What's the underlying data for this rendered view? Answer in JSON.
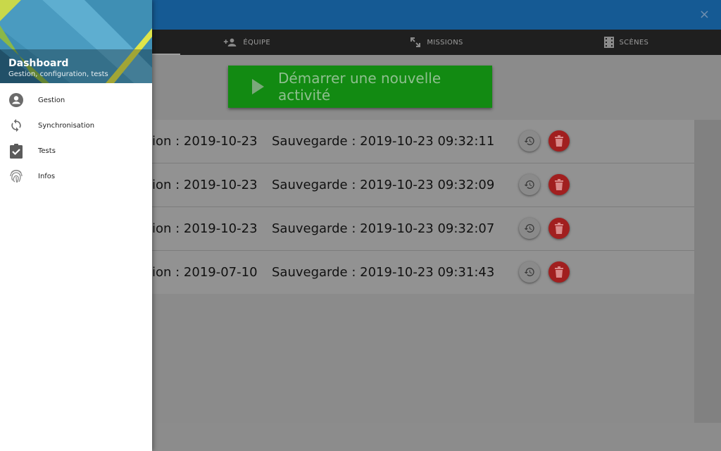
{
  "appbar": {
    "close_label": "×"
  },
  "tabs": [
    {
      "label": "ÉQUIPE",
      "icon": "group-add-icon"
    },
    {
      "label": "MISSIONS",
      "icon": "expand-arrows-icon"
    },
    {
      "label": "SCÈNES",
      "icon": "film-strip-icon"
    }
  ],
  "main": {
    "start_button_label": "Démarrer une nouvelle activité",
    "rows": [
      {
        "created": "ion : 2019-10-23",
        "saved": "Sauvegarde : 2019-10-23 09:32:11"
      },
      {
        "created": "ion : 2019-10-23",
        "saved": "Sauvegarde : 2019-10-23 09:32:09"
      },
      {
        "created": "ion : 2019-10-23",
        "saved": "Sauvegarde : 2019-10-23 09:32:07"
      },
      {
        "created": "ion : 2019-07-10",
        "saved": "Sauvegarde : 2019-10-23 09:31:43"
      }
    ]
  },
  "drawer": {
    "title": "Dashboard",
    "subtitle": "Gestion, configuration, tests",
    "items": [
      {
        "label": "Gestion",
        "icon": "account-circle-icon"
      },
      {
        "label": "Synchronisation",
        "icon": "sync-icon"
      },
      {
        "label": "Tests",
        "icon": "clipboard-check-icon"
      },
      {
        "label": "Infos",
        "icon": "fingerprint-icon"
      }
    ]
  },
  "colors": {
    "appbar": "#155a94",
    "start_button": "#128a12",
    "delete_button": "#a11f1f"
  }
}
